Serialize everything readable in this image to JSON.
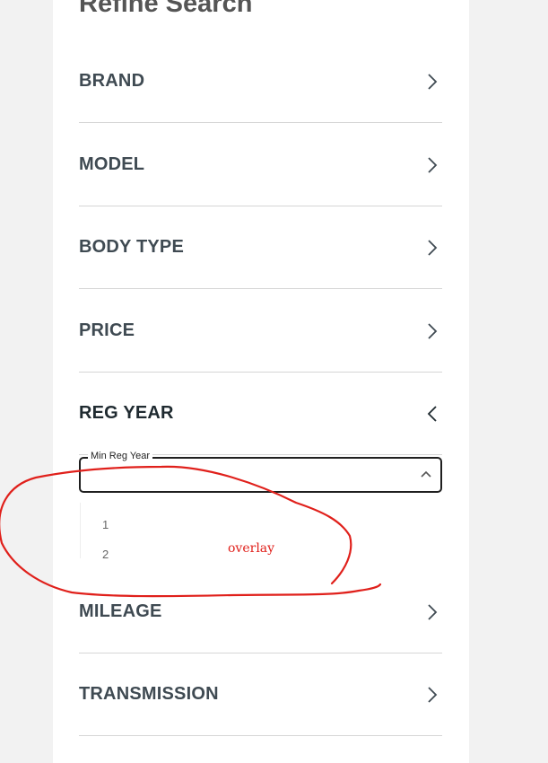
{
  "title": "Refine Search",
  "sections": [
    {
      "label": "BRAND",
      "state": "collapsed",
      "icon": "chevron-right-icon"
    },
    {
      "label": "MODEL",
      "state": "collapsed",
      "icon": "chevron-right-icon"
    },
    {
      "label": "BODY TYPE",
      "state": "collapsed",
      "icon": "chevron-right-icon"
    },
    {
      "label": "PRICE",
      "state": "collapsed",
      "icon": "chevron-right-icon"
    },
    {
      "label": "REG YEAR",
      "state": "expanded",
      "icon": "chevron-left-icon"
    },
    {
      "label": "MILEAGE",
      "state": "collapsed",
      "icon": "chevron-right-icon"
    },
    {
      "label": "TRANSMISSION",
      "state": "collapsed",
      "icon": "chevron-right-icon"
    }
  ],
  "reg_year": {
    "min_field_label": "Min Reg Year",
    "min_field_value": "",
    "caret_icon": "chevron-up-icon",
    "options": [
      "1",
      "2"
    ]
  },
  "annotation": {
    "text": "overlay",
    "color": "#e0201b"
  }
}
